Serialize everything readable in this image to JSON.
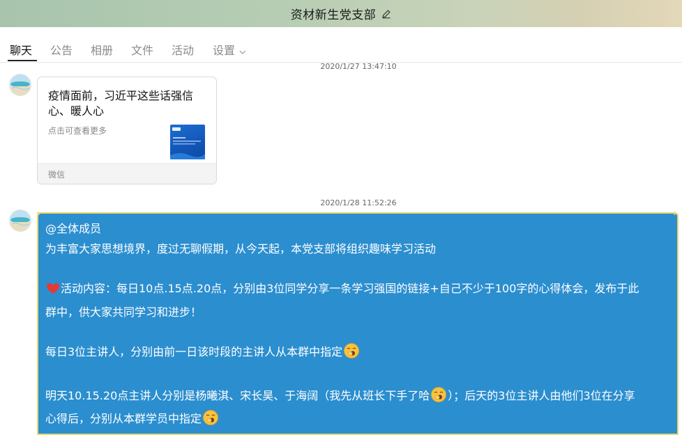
{
  "window": {
    "title": "资材新生党支部"
  },
  "tabs": [
    {
      "label": "聊天",
      "active": true
    },
    {
      "label": "公告"
    },
    {
      "label": "相册"
    },
    {
      "label": "文件"
    },
    {
      "label": "活动"
    },
    {
      "label": "设置",
      "has_dropdown": true
    }
  ],
  "messages": [
    {
      "timestamp": "2020/1/27 13:47:10",
      "card": {
        "title": "疫情面前，习近平这些话强信心、暖人心",
        "subtitle": "点击可查看更多",
        "source": "微信"
      }
    },
    {
      "timestamp": "2020/1/28 11:52:26",
      "lines": {
        "l1": "@全体成员",
        "l2": "为丰富大家思想境界，度过无聊假期，从今天起，本党支部将组织趣味学习活动",
        "l3a": "活动内容：每日10点.15点.20点，分别由3位同学分享一条学习强国的链接+自己不少于100字的心得体会，发布于此",
        "l3b": "群中，供大家共同学习和进步！",
        "l4": "每日3位主讲人，分别由前一日该时段的主讲人从本群中指定",
        "l5a": "明天10.15.20点主讲人分别是杨曦淇、宋长昊、于海阔（我先从班长下手了哈",
        "l5b": "）；后天的3位主讲人由他们3位在分享",
        "l5c": "心得后，分别从本群学员中指定"
      }
    }
  ],
  "icons": {
    "edit": "pencil-icon",
    "heart": "red-heart-emoji",
    "yawn": "yawning-face-emoji",
    "chevron": "chevron-down-icon"
  },
  "colors": {
    "bubble": "#2b8ecf",
    "heart": "#e53935",
    "emoji_face": "#f6c343"
  }
}
